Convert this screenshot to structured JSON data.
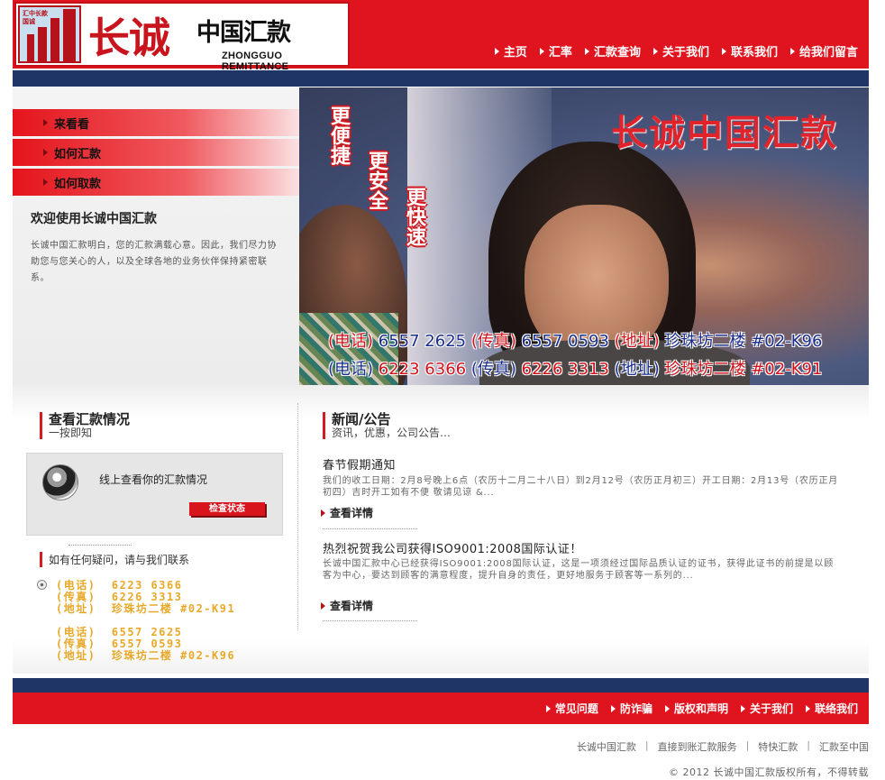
{
  "logo": {
    "emblem_text": "汇中长款国诚",
    "title_cn": "长诚",
    "title_cn2": "中国汇款",
    "title_en": "ZHONGGUO REMITTANCE"
  },
  "topnav": [
    "主页",
    "汇率",
    "汇款查询",
    "关于我们",
    "联系我们",
    "给我们留言"
  ],
  "sidemenu": [
    "来看看",
    "如何汇款",
    "如何取款"
  ],
  "welcome": {
    "title": "欢迎使用长诚中国汇款",
    "body": "长诚中国汇款明白，您的汇款满载心意。因此，我们尽力协助您与您关心的人，以及全球各地的业务伙伴保持紧密联系。"
  },
  "banner": {
    "title": "长诚中国汇款",
    "slogans": [
      "更便捷",
      "更安全",
      "更快速"
    ],
    "line1": {
      "tel_label": "(电话)",
      "tel": "6557 2625",
      "fax_label": "(传真)",
      "fax": "6557 0593",
      "addr_label": "(地址)",
      "addr": "珍珠坊二楼 #02-K96"
    },
    "line2": {
      "tel_label": "(电话)",
      "tel": "6223 6366",
      "fax_label": "(传真)",
      "fax": "6226 3313",
      "addr_label": "(地址)",
      "addr": "珍珠坊二楼 #02-K91"
    }
  },
  "check": {
    "heading": "查看汇款情况",
    "sub": "一按即知",
    "box_text": "线上查看你的汇款情况",
    "button": "检查状态"
  },
  "contact": {
    "heading": "如有任何疑问，请与我们联系",
    "list": "(电话)  6223 6366\n(传真)  6226 3313\n(地址)  珍珠坊二楼 #02-K91\n\n(电话)  6557 2625\n(传真)  6557 0593\n(地址)  珍珠坊二楼 #02-K96"
  },
  "news": {
    "heading": "新闻/公告",
    "sub": "资讯，优惠，公司公告…",
    "items": [
      {
        "title": "春节假期通知",
        "body": "我们的收工日期：2月8号晚上6点（农历十二月二十八日）到2月12号（农历正月初三）开工日期：2月13号（农历正月初四）吉时开工如有不便 敬请见谅        &...",
        "more": "查看详情"
      },
      {
        "title": "热烈祝贺我公司获得ISO9001:2008国际认证！",
        "body": "  长诚中国汇款中心已经获得ISO9001:2008国际认证，这是一项须经过国际品质认证的证书，获得此证书的前提是以顾客为中心，要达到顾客的满意程度，提升自身的责任，更好地服务于顾客等一系列的...",
        "more": "查看详情"
      }
    ]
  },
  "footer": {
    "nav": [
      "常见问题",
      "防诈骗",
      "版权和声明",
      "关于我们",
      "联络我们"
    ],
    "links": [
      "长诚中国汇款",
      "直接到账汇款服务",
      "特快汇款",
      "汇款至中国"
    ],
    "copyright": "© 2012 长诚中国汇款版权所有，不得转载"
  },
  "colors": {
    "brand_red": "#e0141e",
    "navy": "#1f3566",
    "accent_gold": "#e8a92a"
  }
}
